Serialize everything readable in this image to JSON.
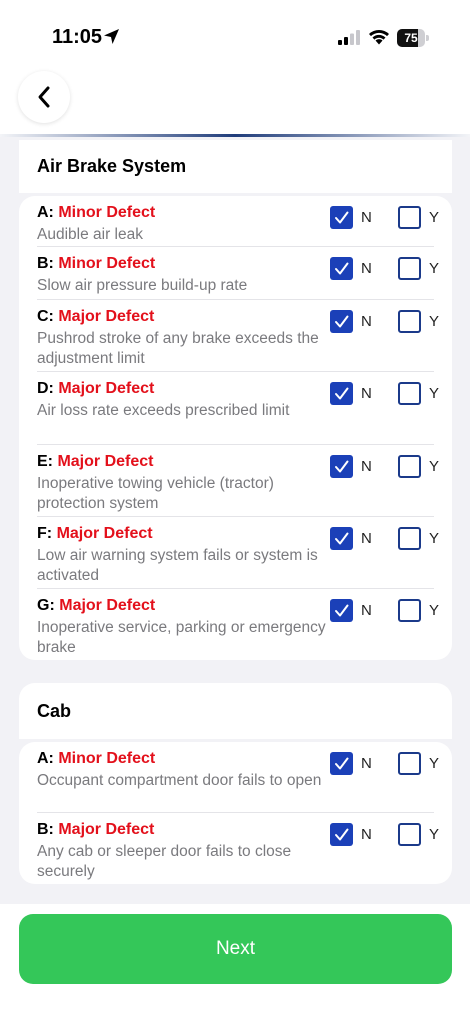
{
  "status_bar": {
    "time": "11:05",
    "battery": "75",
    "battery_level": 0.75
  },
  "sections": [
    {
      "title": "Air Brake System",
      "items": [
        {
          "letter": "A:",
          "severity": "Minor Defect",
          "description": "Audible air leak",
          "n_label": "N",
          "y_label": "Y",
          "n_checked": true,
          "y_checked": false
        },
        {
          "letter": "B:",
          "severity": "Minor Defect",
          "description": "Slow air pressure build-up rate",
          "n_label": "N",
          "y_label": "Y",
          "n_checked": true,
          "y_checked": false
        },
        {
          "letter": "C:",
          "severity": "Major Defect",
          "description": "Pushrod stroke of any brake exceeds the adjustment limit",
          "n_label": "N",
          "y_label": "Y",
          "n_checked": true,
          "y_checked": false
        },
        {
          "letter": "D:",
          "severity": "Major Defect",
          "description": "Air loss rate exceeds prescribed limit",
          "n_label": "N",
          "y_label": "Y",
          "n_checked": true,
          "y_checked": false
        },
        {
          "letter": "E:",
          "severity": "Major Defect",
          "description": "Inoperative towing vehicle (tractor) protection system",
          "n_label": "N",
          "y_label": "Y",
          "n_checked": true,
          "y_checked": false
        },
        {
          "letter": "F:",
          "severity": "Major Defect",
          "description": "Low air warning system fails or system is activated",
          "n_label": "N",
          "y_label": "Y",
          "n_checked": true,
          "y_checked": false
        },
        {
          "letter": "G:",
          "severity": "Major Defect",
          "description": "Inoperative service, parking or emergency brake",
          "n_label": "N",
          "y_label": "Y",
          "n_checked": true,
          "y_checked": false
        }
      ]
    },
    {
      "title": "Cab",
      "items": [
        {
          "letter": "A:",
          "severity": "Minor Defect",
          "description": "Occupant compartment door fails to open",
          "n_label": "N",
          "y_label": "Y",
          "n_checked": true,
          "y_checked": false
        },
        {
          "letter": "B:",
          "severity": "Major Defect",
          "description": "Any cab or sleeper door fails to close securely",
          "n_label": "N",
          "y_label": "Y",
          "n_checked": true,
          "y_checked": false
        }
      ]
    }
  ],
  "next_button": {
    "label": "Next"
  },
  "colors": {
    "severity": "#e3101b",
    "checkbox": "#1b40b8",
    "next": "#34c759"
  },
  "icons": {
    "back": "chevron-left-icon",
    "location": "location-arrow-icon",
    "signal": "cellular-signal-icon",
    "wifi": "wifi-icon",
    "battery": "battery-icon",
    "check": "checkmark-icon"
  }
}
